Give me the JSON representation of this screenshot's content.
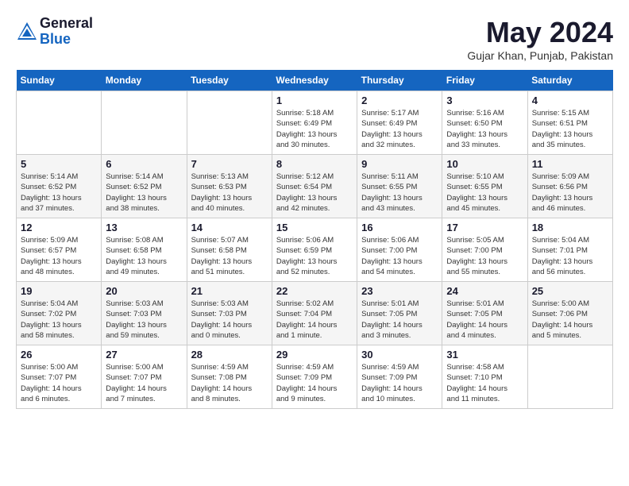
{
  "header": {
    "logo_general": "General",
    "logo_blue": "Blue",
    "month_title": "May 2024",
    "location": "Gujar Khan, Punjab, Pakistan"
  },
  "calendar": {
    "days_of_week": [
      "Sunday",
      "Monday",
      "Tuesday",
      "Wednesday",
      "Thursday",
      "Friday",
      "Saturday"
    ],
    "weeks": [
      [
        {
          "day": "",
          "info": ""
        },
        {
          "day": "",
          "info": ""
        },
        {
          "day": "",
          "info": ""
        },
        {
          "day": "1",
          "info": "Sunrise: 5:18 AM\nSunset: 6:49 PM\nDaylight: 13 hours\nand 30 minutes."
        },
        {
          "day": "2",
          "info": "Sunrise: 5:17 AM\nSunset: 6:49 PM\nDaylight: 13 hours\nand 32 minutes."
        },
        {
          "day": "3",
          "info": "Sunrise: 5:16 AM\nSunset: 6:50 PM\nDaylight: 13 hours\nand 33 minutes."
        },
        {
          "day": "4",
          "info": "Sunrise: 5:15 AM\nSunset: 6:51 PM\nDaylight: 13 hours\nand 35 minutes."
        }
      ],
      [
        {
          "day": "5",
          "info": "Sunrise: 5:14 AM\nSunset: 6:52 PM\nDaylight: 13 hours\nand 37 minutes."
        },
        {
          "day": "6",
          "info": "Sunrise: 5:14 AM\nSunset: 6:52 PM\nDaylight: 13 hours\nand 38 minutes."
        },
        {
          "day": "7",
          "info": "Sunrise: 5:13 AM\nSunset: 6:53 PM\nDaylight: 13 hours\nand 40 minutes."
        },
        {
          "day": "8",
          "info": "Sunrise: 5:12 AM\nSunset: 6:54 PM\nDaylight: 13 hours\nand 42 minutes."
        },
        {
          "day": "9",
          "info": "Sunrise: 5:11 AM\nSunset: 6:55 PM\nDaylight: 13 hours\nand 43 minutes."
        },
        {
          "day": "10",
          "info": "Sunrise: 5:10 AM\nSunset: 6:55 PM\nDaylight: 13 hours\nand 45 minutes."
        },
        {
          "day": "11",
          "info": "Sunrise: 5:09 AM\nSunset: 6:56 PM\nDaylight: 13 hours\nand 46 minutes."
        }
      ],
      [
        {
          "day": "12",
          "info": "Sunrise: 5:09 AM\nSunset: 6:57 PM\nDaylight: 13 hours\nand 48 minutes."
        },
        {
          "day": "13",
          "info": "Sunrise: 5:08 AM\nSunset: 6:58 PM\nDaylight: 13 hours\nand 49 minutes."
        },
        {
          "day": "14",
          "info": "Sunrise: 5:07 AM\nSunset: 6:58 PM\nDaylight: 13 hours\nand 51 minutes."
        },
        {
          "day": "15",
          "info": "Sunrise: 5:06 AM\nSunset: 6:59 PM\nDaylight: 13 hours\nand 52 minutes."
        },
        {
          "day": "16",
          "info": "Sunrise: 5:06 AM\nSunset: 7:00 PM\nDaylight: 13 hours\nand 54 minutes."
        },
        {
          "day": "17",
          "info": "Sunrise: 5:05 AM\nSunset: 7:00 PM\nDaylight: 13 hours\nand 55 minutes."
        },
        {
          "day": "18",
          "info": "Sunrise: 5:04 AM\nSunset: 7:01 PM\nDaylight: 13 hours\nand 56 minutes."
        }
      ],
      [
        {
          "day": "19",
          "info": "Sunrise: 5:04 AM\nSunset: 7:02 PM\nDaylight: 13 hours\nand 58 minutes."
        },
        {
          "day": "20",
          "info": "Sunrise: 5:03 AM\nSunset: 7:03 PM\nDaylight: 13 hours\nand 59 minutes."
        },
        {
          "day": "21",
          "info": "Sunrise: 5:03 AM\nSunset: 7:03 PM\nDaylight: 14 hours\nand 0 minutes."
        },
        {
          "day": "22",
          "info": "Sunrise: 5:02 AM\nSunset: 7:04 PM\nDaylight: 14 hours\nand 1 minute."
        },
        {
          "day": "23",
          "info": "Sunrise: 5:01 AM\nSunset: 7:05 PM\nDaylight: 14 hours\nand 3 minutes."
        },
        {
          "day": "24",
          "info": "Sunrise: 5:01 AM\nSunset: 7:05 PM\nDaylight: 14 hours\nand 4 minutes."
        },
        {
          "day": "25",
          "info": "Sunrise: 5:00 AM\nSunset: 7:06 PM\nDaylight: 14 hours\nand 5 minutes."
        }
      ],
      [
        {
          "day": "26",
          "info": "Sunrise: 5:00 AM\nSunset: 7:07 PM\nDaylight: 14 hours\nand 6 minutes."
        },
        {
          "day": "27",
          "info": "Sunrise: 5:00 AM\nSunset: 7:07 PM\nDaylight: 14 hours\nand 7 minutes."
        },
        {
          "day": "28",
          "info": "Sunrise: 4:59 AM\nSunset: 7:08 PM\nDaylight: 14 hours\nand 8 minutes."
        },
        {
          "day": "29",
          "info": "Sunrise: 4:59 AM\nSunset: 7:09 PM\nDaylight: 14 hours\nand 9 minutes."
        },
        {
          "day": "30",
          "info": "Sunrise: 4:59 AM\nSunset: 7:09 PM\nDaylight: 14 hours\nand 10 minutes."
        },
        {
          "day": "31",
          "info": "Sunrise: 4:58 AM\nSunset: 7:10 PM\nDaylight: 14 hours\nand 11 minutes."
        },
        {
          "day": "",
          "info": ""
        }
      ]
    ]
  }
}
